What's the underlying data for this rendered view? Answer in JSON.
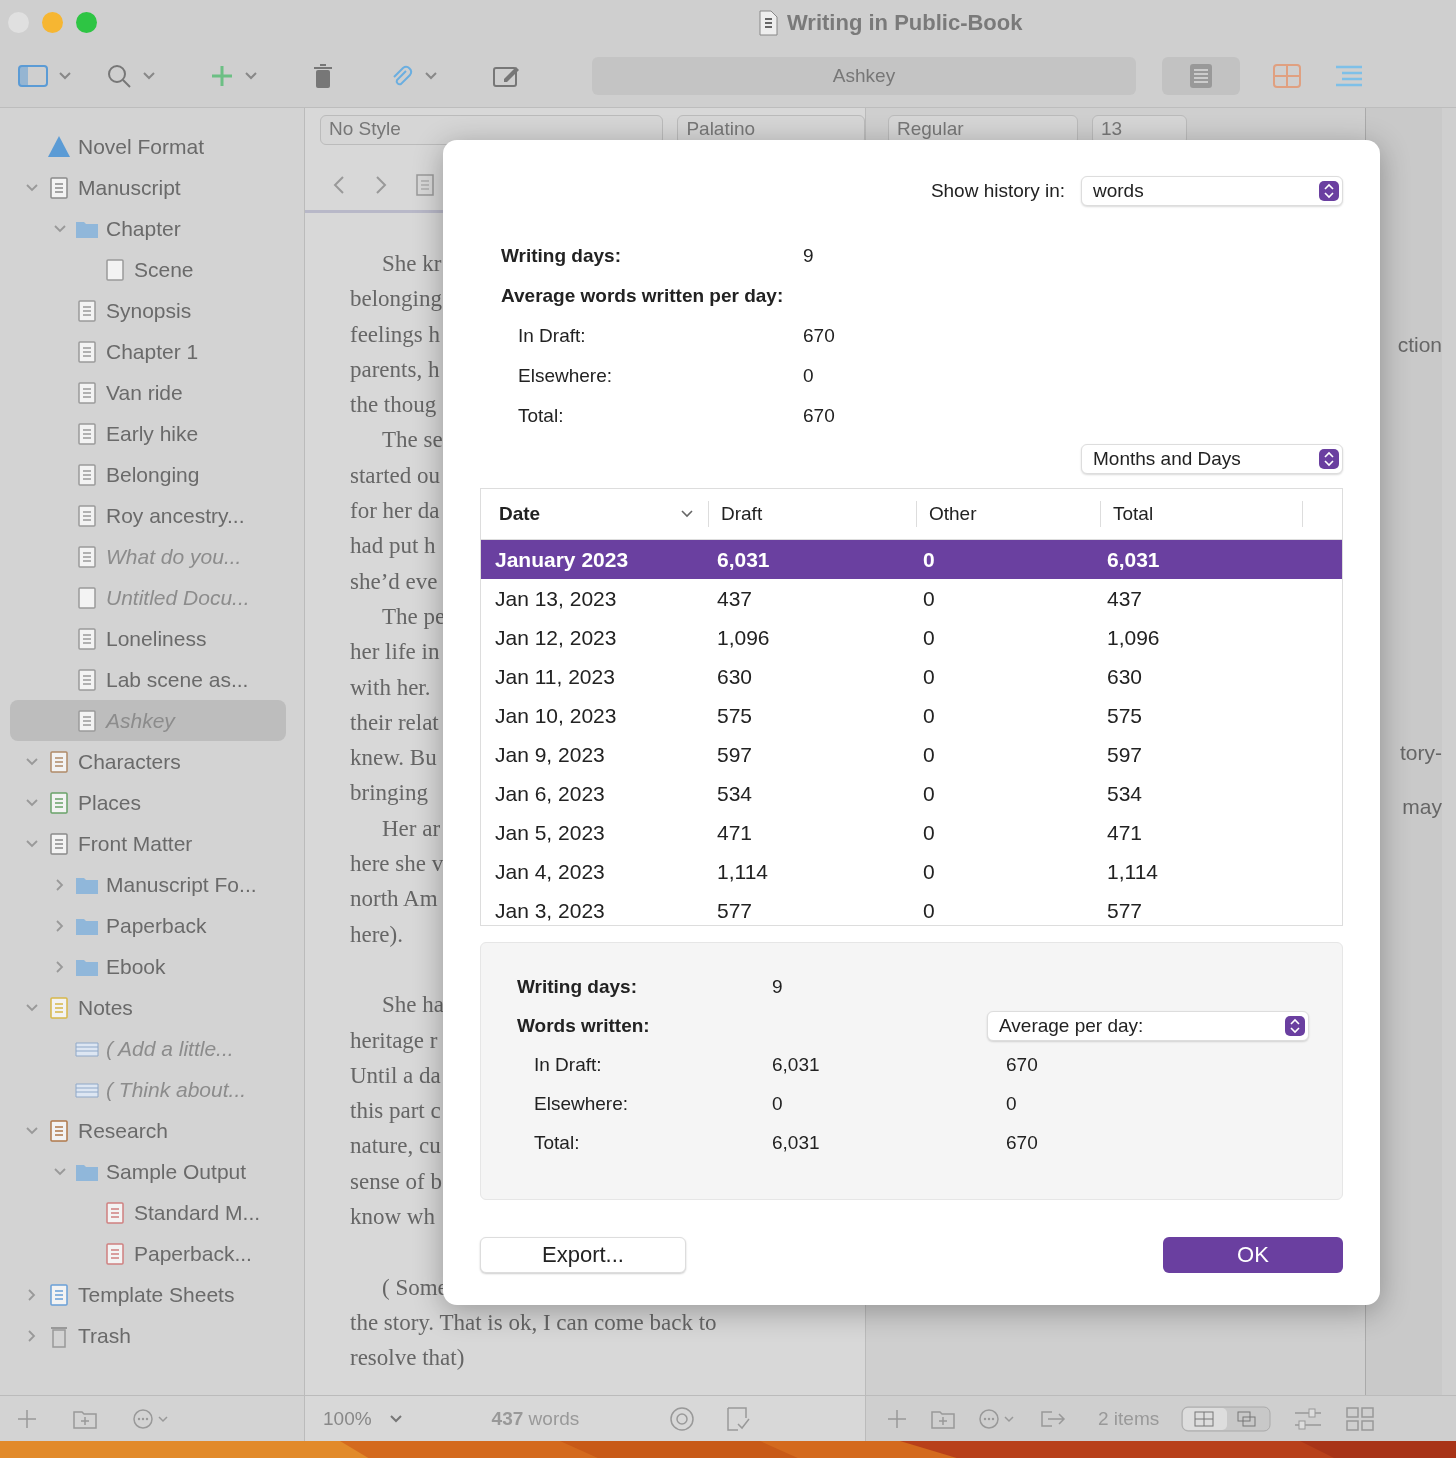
{
  "window": {
    "title": "Writing in Public-Book"
  },
  "toolbar": {
    "document_title": "Ashkey"
  },
  "format_bar": {
    "style": "No Style",
    "font": "Palatino",
    "weight": "Regular",
    "size": "13"
  },
  "binder": [
    {
      "label": "Novel Format",
      "kind": "warning",
      "italic": false,
      "selected": false
    },
    {
      "label": "Manuscript",
      "kind": "book",
      "italic": false,
      "selected": false,
      "expanded": true,
      "children": [
        {
          "label": "Chapter",
          "kind": "folder",
          "italic": false,
          "selected": false,
          "expanded": true,
          "children": [
            {
              "label": "Scene",
              "kind": "blank",
              "italic": false,
              "selected": false
            }
          ]
        },
        {
          "label": "Synopsis",
          "kind": "text",
          "italic": false,
          "selected": false
        },
        {
          "label": "Chapter 1",
          "kind": "text",
          "italic": false,
          "selected": false
        },
        {
          "label": "Van ride",
          "kind": "text",
          "italic": false,
          "selected": false
        },
        {
          "label": "Early hike",
          "kind": "text",
          "italic": false,
          "selected": false
        },
        {
          "label": "Belonging",
          "kind": "text",
          "italic": false,
          "selected": false
        },
        {
          "label": "Roy ancestry...",
          "kind": "text",
          "italic": false,
          "selected": false
        },
        {
          "label": "What do you...",
          "kind": "text",
          "italic": true,
          "selected": false
        },
        {
          "label": "Untitled Docu...",
          "kind": "blank",
          "italic": true,
          "selected": false
        },
        {
          "label": "Loneliness",
          "kind": "text",
          "italic": false,
          "selected": false
        },
        {
          "label": "Lab scene as...",
          "kind": "text",
          "italic": false,
          "selected": false
        },
        {
          "label": "Ashkey",
          "kind": "text",
          "italic": true,
          "selected": true
        }
      ]
    },
    {
      "label": "Characters",
      "kind": "characters",
      "italic": false,
      "selected": false,
      "expanded": true
    },
    {
      "label": "Places",
      "kind": "places",
      "italic": false,
      "selected": false,
      "expanded": true
    },
    {
      "label": "Front Matter",
      "kind": "book",
      "italic": false,
      "selected": false,
      "expanded": true,
      "children": [
        {
          "label": "Manuscript Fo...",
          "kind": "folder",
          "italic": false,
          "selected": false,
          "expanded": false
        },
        {
          "label": "Paperback",
          "kind": "folder",
          "italic": false,
          "selected": false,
          "expanded": false
        },
        {
          "label": "Ebook",
          "kind": "folder",
          "italic": false,
          "selected": false,
          "expanded": false
        }
      ]
    },
    {
      "label": "Notes",
      "kind": "notes",
      "italic": false,
      "selected": false,
      "expanded": true,
      "children": [
        {
          "label": "( Add a little...",
          "kind": "note",
          "italic": true,
          "selected": false
        },
        {
          "label": "( Think about...",
          "kind": "note",
          "italic": true,
          "selected": false
        }
      ]
    },
    {
      "label": "Research",
      "kind": "research",
      "italic": false,
      "selected": false,
      "expanded": true,
      "children": [
        {
          "label": "Sample Output",
          "kind": "folder",
          "italic": false,
          "selected": false,
          "expanded": true,
          "children": [
            {
              "label": "Standard M...",
              "kind": "pdf",
              "italic": false,
              "selected": false
            },
            {
              "label": "Paperback...",
              "kind": "pdf",
              "italic": false,
              "selected": false
            }
          ]
        }
      ]
    },
    {
      "label": "Template Sheets",
      "kind": "template",
      "italic": false,
      "selected": false,
      "expanded": false
    },
    {
      "label": "Trash",
      "kind": "trash",
      "italic": false,
      "selected": false,
      "expanded": false
    }
  ],
  "editor_paragraphs": [
    {
      "space_before": false,
      "lines": [
        "She kr",
        "belonging",
        "feelings h",
        "parents, h",
        "the thoug"
      ]
    },
    {
      "space_before": false,
      "lines": [
        "The se",
        "started ou",
        "for her da",
        "had put h",
        "she’d eve"
      ]
    },
    {
      "space_before": false,
      "lines": [
        "The pe",
        "her life in",
        "with her.",
        "their relat",
        "knew. Bu",
        "bringing"
      ]
    },
    {
      "space_before": false,
      "lines": [
        "Her ar",
        "here she v",
        "north Am",
        "here)."
      ]
    },
    {
      "space_before": true,
      "lines": [
        "She ha",
        "heritage r",
        "Until a da",
        "this part c",
        "nature, cu",
        "sense of b",
        "know wh"
      ]
    },
    {
      "space_before": true,
      "lines": [
        "( Some",
        "the story. That is ok, I can come back to",
        "resolve that)"
      ]
    }
  ],
  "inspector_fragments": [
    "ction",
    "tory-",
    "may"
  ],
  "editor_footer": {
    "zoom": "100%",
    "count": "437",
    "count_unit": "words"
  },
  "corkboard_footer": {
    "items": "2 items"
  },
  "dialog": {
    "show_history_label": "Show history in:",
    "show_history_value": "words",
    "writing_days_label": "Writing days:",
    "writing_days": "9",
    "average_label": "Average words written per day:",
    "averages": [
      {
        "label": "In Draft:",
        "value": "670"
      },
      {
        "label": "Elsewhere:",
        "value": "0"
      },
      {
        "label": "Total:",
        "value": "670"
      }
    ],
    "grouping": "Months and Days",
    "table": {
      "columns": [
        "Date",
        "Draft",
        "Other",
        "Total"
      ],
      "rows": [
        {
          "cells": [
            "January 2023",
            "6,031",
            "0",
            "6,031"
          ],
          "kind": "month",
          "selected": true
        },
        {
          "cells": [
            "Jan 13, 2023",
            "437",
            "0",
            "437"
          ],
          "kind": "day",
          "selected": false
        },
        {
          "cells": [
            "Jan 12, 2023",
            "1,096",
            "0",
            "1,096"
          ],
          "kind": "day",
          "selected": false
        },
        {
          "cells": [
            "Jan 11, 2023",
            "630",
            "0",
            "630"
          ],
          "kind": "day",
          "selected": false
        },
        {
          "cells": [
            "Jan 10, 2023",
            "575",
            "0",
            "575"
          ],
          "kind": "day",
          "selected": false
        },
        {
          "cells": [
            "Jan 9, 2023",
            "597",
            "0",
            "597"
          ],
          "kind": "day",
          "selected": false
        },
        {
          "cells": [
            "Jan 6, 2023",
            "534",
            "0",
            "534"
          ],
          "kind": "day",
          "selected": false
        },
        {
          "cells": [
            "Jan 5, 2023",
            "471",
            "0",
            "471"
          ],
          "kind": "day",
          "selected": false
        },
        {
          "cells": [
            "Jan 4, 2023",
            "1,114",
            "0",
            "1,114"
          ],
          "kind": "day",
          "selected": false
        },
        {
          "cells": [
            "Jan 3, 2023",
            "577",
            "0",
            "577"
          ],
          "kind": "day",
          "selected": false
        }
      ]
    },
    "summary": {
      "writing_days_label": "Writing days:",
      "writing_days": "9",
      "words_label": "Words written:",
      "mode": "Average per day:",
      "rows": [
        {
          "label": "In Draft:",
          "total": "6,031",
          "average": "670"
        },
        {
          "label": "Elsewhere:",
          "total": "0",
          "average": "0"
        },
        {
          "label": "Total:",
          "total": "6,031",
          "average": "670"
        }
      ]
    },
    "buttons": {
      "export": "Export...",
      "ok": "OK"
    }
  }
}
